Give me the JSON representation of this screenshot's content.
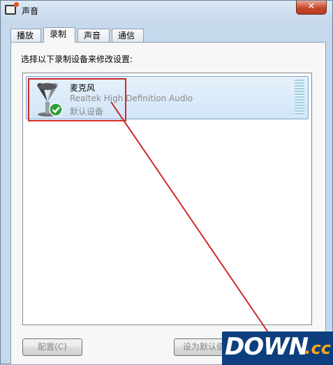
{
  "window": {
    "title": "声音",
    "close_label": "✕"
  },
  "tabs": [
    {
      "label": "播放"
    },
    {
      "label": "录制"
    },
    {
      "label": "声音"
    },
    {
      "label": "通信"
    }
  ],
  "recording": {
    "prompt": "选择以下录制设备来修改设置:",
    "devices": [
      {
        "name": "麦克风",
        "driver": "Realtek High Definition Audio",
        "status": "默认设备",
        "icon": "microphone-icon",
        "is_default": true
      }
    ]
  },
  "buttons": {
    "configure": "配置(C)",
    "set_default": "设为默认值(S"
  },
  "watermark": {
    "main": "DOWN",
    "suffix": ".cc"
  },
  "colors": {
    "highlight": "#cc2a2a",
    "selection": "#d1e5f8",
    "check": "#2e9e3a"
  }
}
